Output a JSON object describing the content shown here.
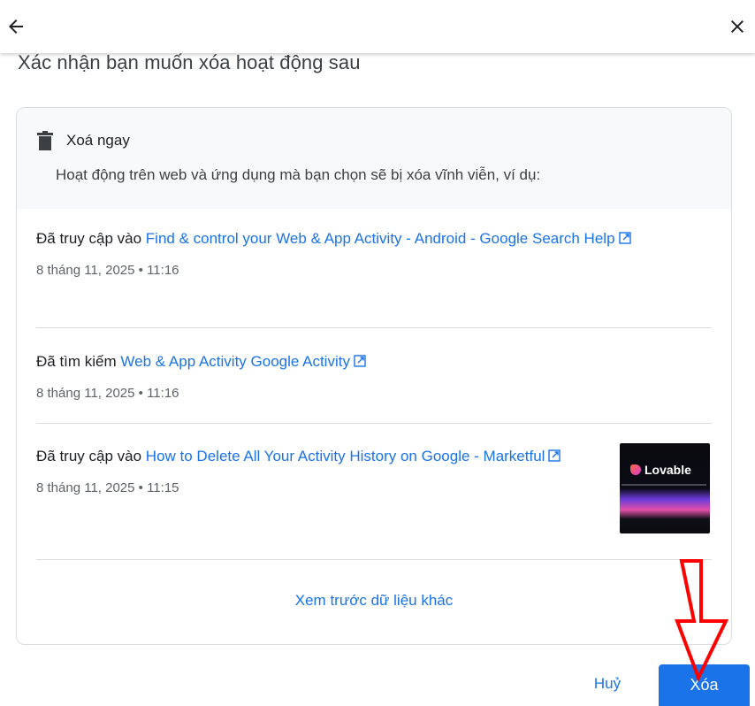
{
  "header": {
    "back_icon": "arrow-left-icon",
    "close_icon": "close-icon"
  },
  "heading": "Xác nhận bạn muốn xóa hoạt động sau",
  "card": {
    "title": "Xoá ngay",
    "description": "Hoạt động trên web và ứng dụng mà bạn chọn sẽ bị xóa vĩnh viễn, ví dụ:",
    "items": [
      {
        "prefix": "Đã truy cập vào",
        "link": "Find & control your Web & App Activity - Android - Google Search Help",
        "time": "8 tháng 11, 2025 • 11:16"
      },
      {
        "prefix": "Đã tìm kiếm",
        "link": "Web & App Activity Google Activity",
        "time": "8 tháng 11, 2025 • 11:16"
      },
      {
        "prefix": "Đã truy cập vào",
        "link": "How to Delete All Your Activity History on Google - Marketful",
        "time": "8 tháng 11, 2025 • 11:15",
        "thumbnail_text": "Lovable"
      }
    ],
    "more_link": "Xem trước dữ liệu khác"
  },
  "footer": {
    "cancel_label": "Huỷ",
    "delete_label": "Xóa"
  },
  "colors": {
    "accent": "#1a73e8",
    "annotation": "#ff0000"
  }
}
